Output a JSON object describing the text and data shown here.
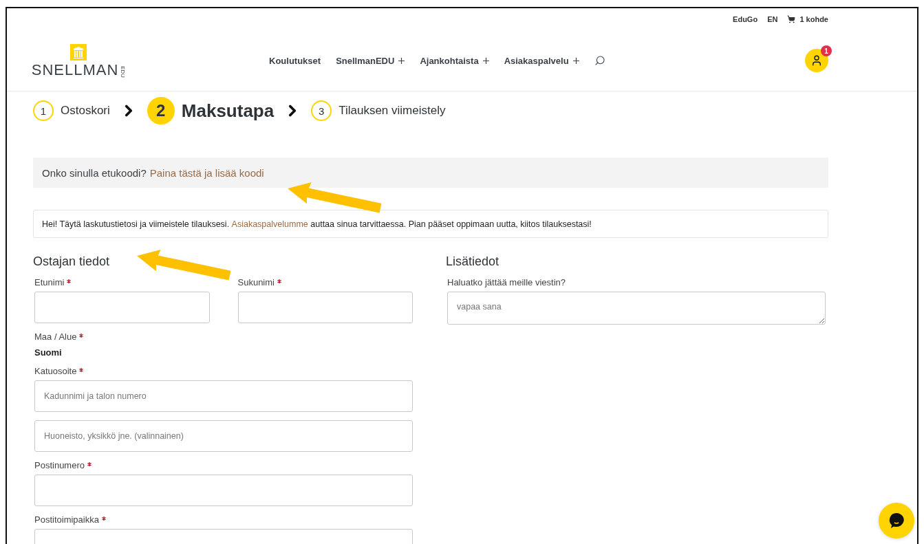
{
  "top_links": [
    {
      "kind": "link",
      "label": "EduGo"
    },
    {
      "kind": "link",
      "label": "EN"
    },
    {
      "kind": "cart",
      "label": "1 kohde"
    }
  ],
  "logo": {
    "text": "SNELLMAN",
    "suffix": "EDU"
  },
  "nav": [
    {
      "label": "Koulutukset",
      "expandable": false
    },
    {
      "label": "SnellmanEDU",
      "expandable": true
    },
    {
      "label": "Ajankohtaista",
      "expandable": true
    },
    {
      "label": "Asiakaspalvelu",
      "expandable": true
    }
  ],
  "account": {
    "badge": "1"
  },
  "steps": [
    {
      "number": "1",
      "label": "Ostoskori",
      "selected": false
    },
    {
      "number": "2",
      "label": "Maksutapa",
      "selected": true
    },
    {
      "number": "3",
      "label": "Tilauksen viimeistely",
      "selected": false
    }
  ],
  "coupon": {
    "text": "Onko sinulla etukoodi?",
    "link": "Paina tästä ja lisää koodi"
  },
  "notice": {
    "before": "Hei! Täytä laskutustietosi ja viimeistele tilauksesi.",
    "link": "Asiakaspalvelumme",
    "after": "auttaa sinua tarvittaessa. Pian pääset oppimaan uutta, kiitos tilauksestasi!"
  },
  "billing": {
    "title": "Ostajan tiedot",
    "rows": [
      [
        {
          "kind": "input",
          "label": "Etunimi",
          "required": true
        },
        {
          "kind": "input",
          "label": "Sukunimi",
          "required": true
        }
      ],
      [
        {
          "kind": "static",
          "label": "Maa / Alue",
          "required": true,
          "value": "Suomi"
        }
      ],
      [
        {
          "kind": "input",
          "label": "Katuosoite",
          "required": true,
          "placeholder": "Kadunnimi ja talon numero"
        }
      ],
      [
        {
          "kind": "input",
          "placeholder": "Huoneisto, yksikkö jne. (valinnainen)"
        }
      ],
      [
        {
          "kind": "input",
          "label": "Postinumero",
          "required": true
        }
      ],
      [
        {
          "kind": "input",
          "label": "Postitoimipaikka",
          "required": true
        }
      ]
    ]
  },
  "additional": {
    "title": "Lisätiedot",
    "fields": [
      {
        "kind": "textarea",
        "label": "Haluatko jättää meille viestin?",
        "required": false,
        "placeholder": "vapaa sana"
      }
    ]
  }
}
